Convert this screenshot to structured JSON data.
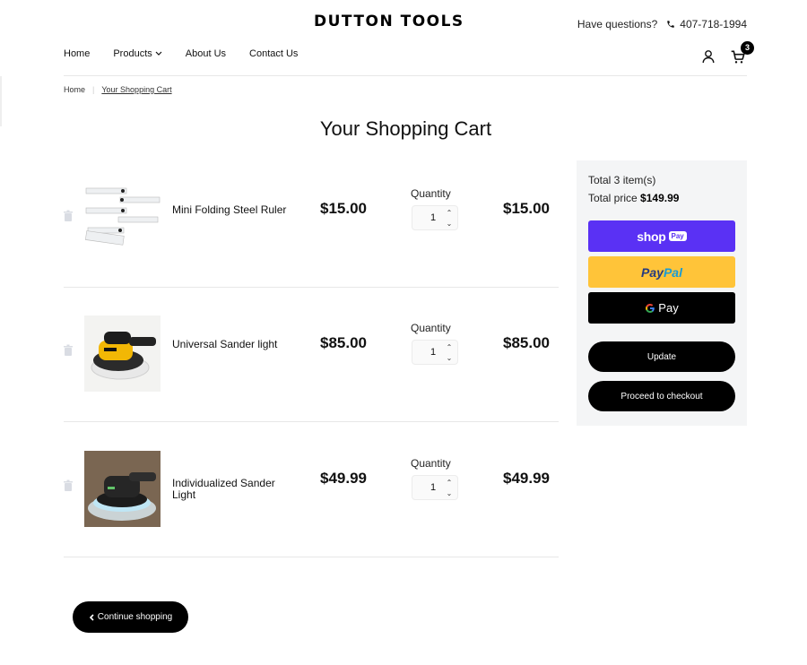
{
  "brand": {
    "logo": "DUTTON TOOLS"
  },
  "header": {
    "help_text": "Have questions?",
    "phone": "407-718-1994",
    "cart_count": "3",
    "icons": {
      "phone": "phone-icon",
      "account": "user-icon",
      "cart": "cart-icon"
    }
  },
  "nav": {
    "items": [
      {
        "label": "Home"
      },
      {
        "label": "Products",
        "has_dropdown": true
      },
      {
        "label": "About Us"
      },
      {
        "label": "Contact Us"
      }
    ]
  },
  "breadcrumb": {
    "home": "Home",
    "current": "Your Shopping Cart"
  },
  "page": {
    "title": "Your Shopping Cart"
  },
  "cart": {
    "qty_label": "Quantity",
    "items": [
      {
        "name": "Mini Folding Steel Ruler",
        "price": "$15.00",
        "quantity": "1",
        "total": "$15.00"
      },
      {
        "name": "Universal Sander light",
        "price": "$85.00",
        "quantity": "1",
        "total": "$85.00"
      },
      {
        "name": "Individualized Sander Light",
        "price": "$49.99",
        "quantity": "1",
        "total": "$49.99"
      }
    ]
  },
  "summary": {
    "items_label": "Total 3 item(s)",
    "price_label": "Total price",
    "price_value": "$149.99",
    "shoppay_text": "shop",
    "shoppay_badge": "Pay",
    "paypal_pay": "Pay",
    "paypal_pal": "Pal",
    "gpay_text": "Pay",
    "update_label": "Update",
    "checkout_label": "Proceed to checkout"
  },
  "footer_actions": {
    "continue_label": "Continue shopping"
  },
  "colors": {
    "shoppay": "#5a31f4",
    "paypal": "#ffc439",
    "paypal_dark": "#253b80",
    "paypal_light": "#179bd7",
    "black": "#000000",
    "panel": "#f4f5f6"
  }
}
